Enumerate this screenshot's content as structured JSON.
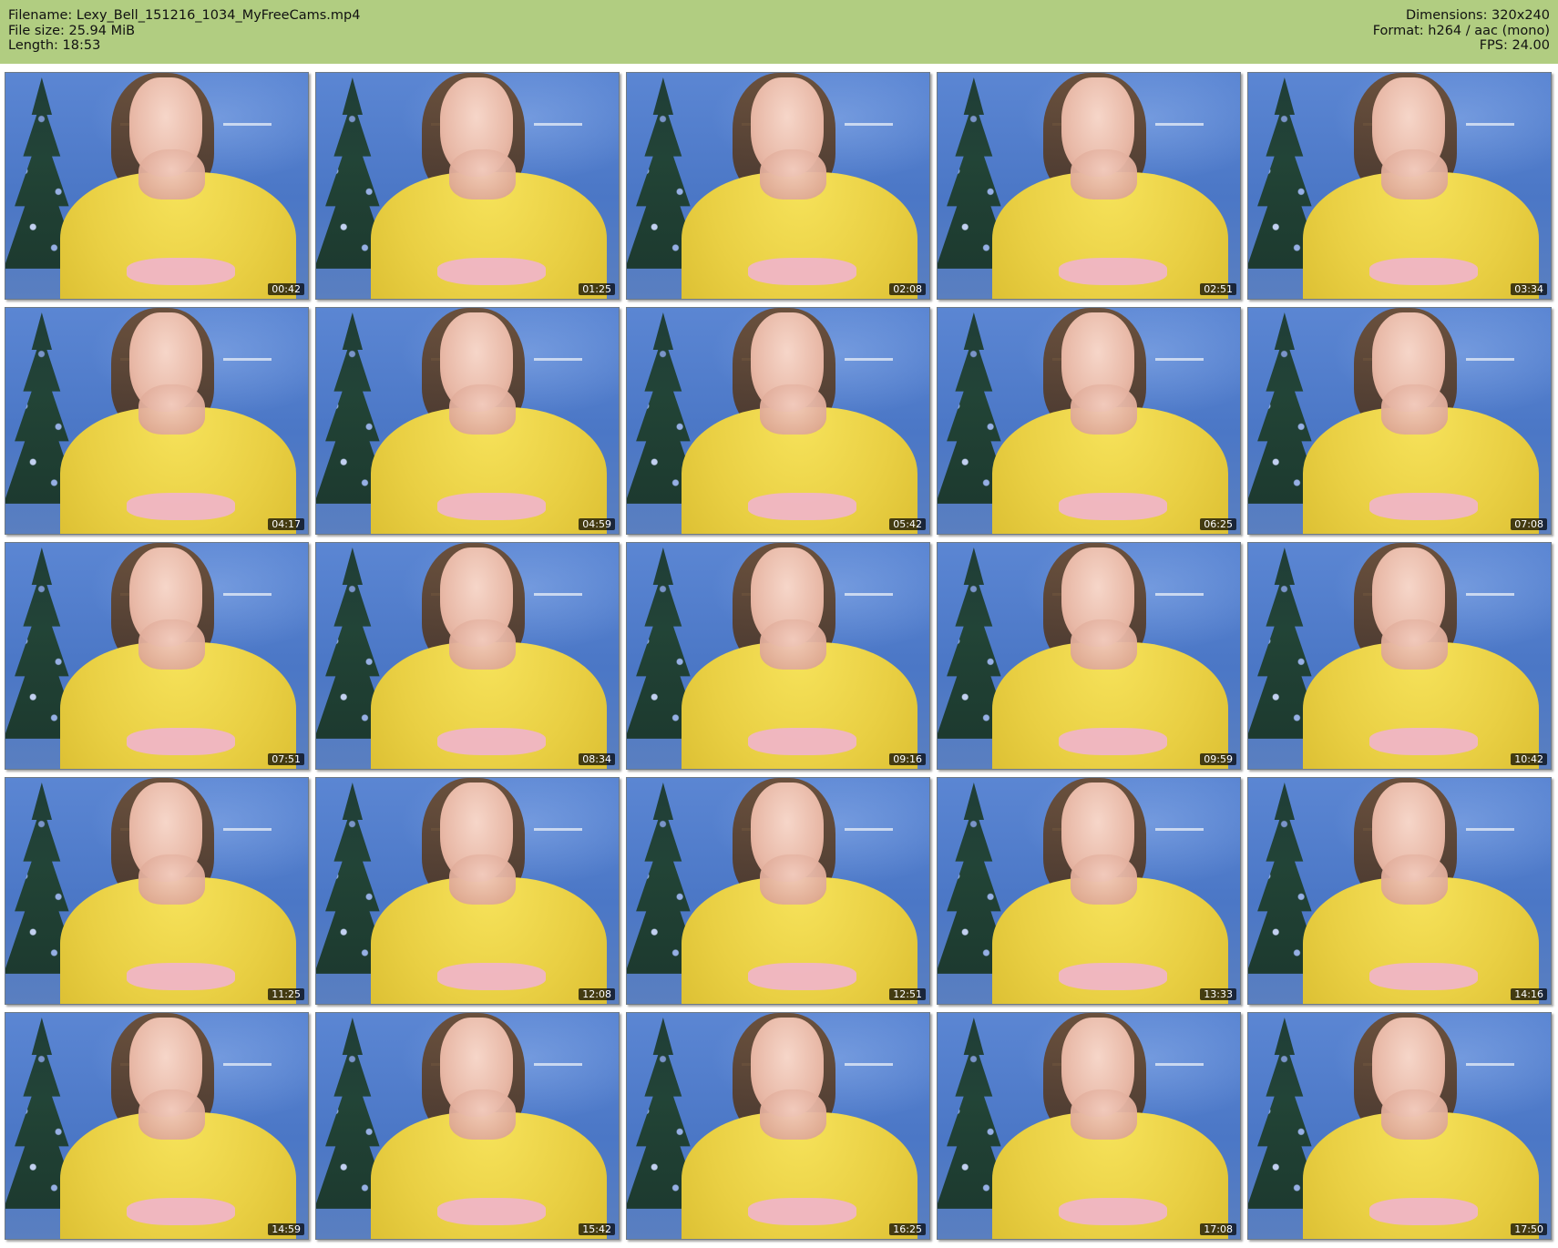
{
  "header": {
    "left": [
      "Filename: Lexy_Bell_151216_1034_MyFreeCams.mp4",
      "File size: 25.94 MiB",
      "Length: 18:53"
    ],
    "right": [
      "Dimensions: 320x240",
      "Format: h264 / aac (mono)",
      "FPS: 24.00"
    ]
  },
  "thumbnails": [
    "00:42",
    "01:25",
    "02:08",
    "02:51",
    "03:34",
    "04:17",
    "04:59",
    "05:42",
    "06:25",
    "07:08",
    "07:51",
    "08:34",
    "09:16",
    "09:59",
    "10:42",
    "11:25",
    "12:08",
    "12:51",
    "13:33",
    "14:16",
    "14:59",
    "15:42",
    "16:25",
    "17:08",
    "17:50"
  ]
}
